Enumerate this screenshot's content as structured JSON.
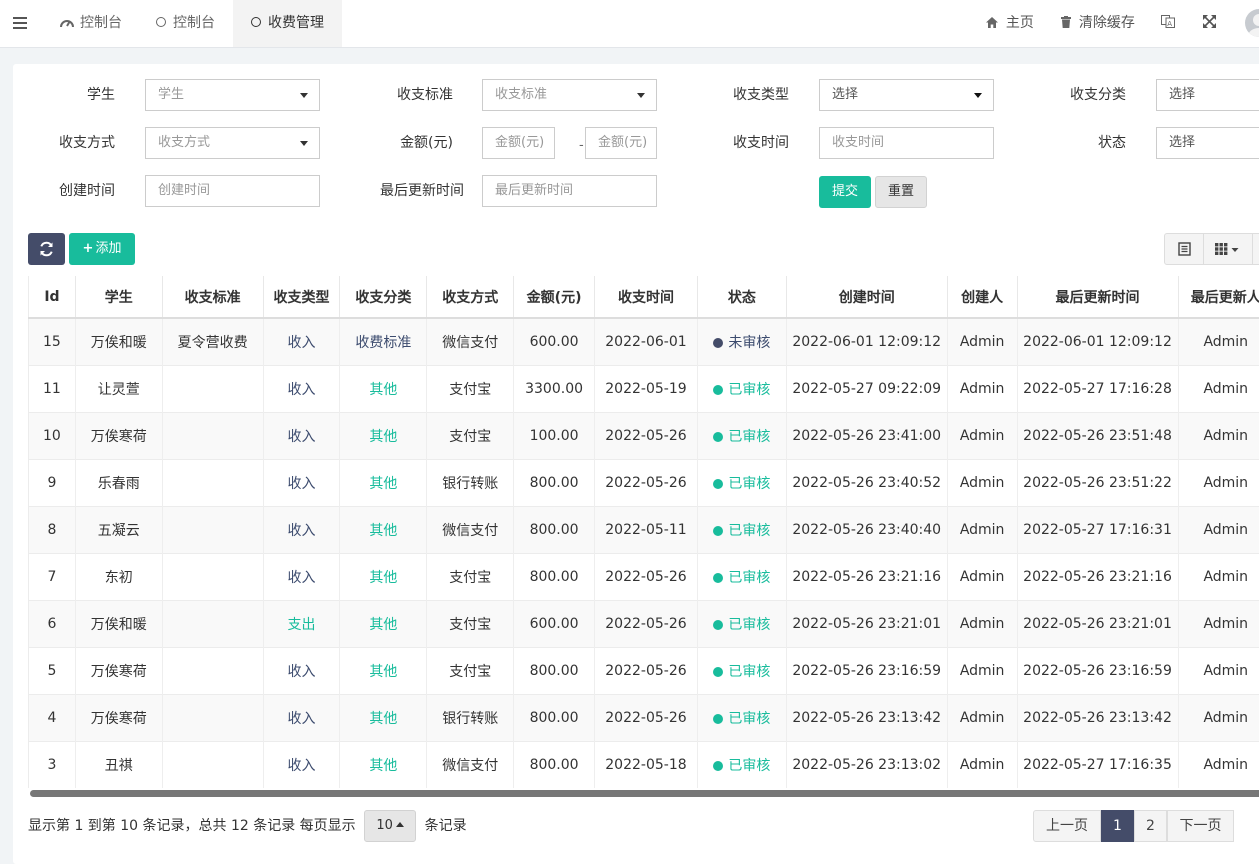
{
  "header": {
    "tabs": [
      {
        "label": "控制台",
        "icon": "dashboard-icon",
        "active": false
      },
      {
        "label": "控制台",
        "icon": "circle-icon",
        "active": false
      },
      {
        "label": "收费管理",
        "icon": "circle-icon",
        "active": true
      }
    ],
    "home_label": "主页",
    "clear_cache_label": "清除缓存"
  },
  "filters": {
    "student": {
      "label": "学生",
      "placeholder": "学生"
    },
    "standard": {
      "label": "收支标准",
      "placeholder": "收支标准"
    },
    "type": {
      "label": "收支类型",
      "value": "选择"
    },
    "category": {
      "label": "收支分类",
      "value": "选择"
    },
    "method": {
      "label": "收支方式",
      "placeholder": "收支方式"
    },
    "amount": {
      "label": "金额(元)",
      "min_placeholder": "金额(元)",
      "max_placeholder": "金额(元)",
      "separator": "-"
    },
    "time": {
      "label": "收支时间",
      "placeholder": "收支时间"
    },
    "status": {
      "label": "状态",
      "value": "选择"
    },
    "created": {
      "label": "创建时间",
      "placeholder": "创建时间"
    },
    "updated": {
      "label": "最后更新时间",
      "placeholder": "最后更新时间"
    },
    "submit_label": "提交",
    "reset_label": "重置"
  },
  "toolbar": {
    "add_label": "添加"
  },
  "table": {
    "headers": [
      "Id",
      "学生",
      "收支标准",
      "收支类型",
      "收支分类",
      "收支方式",
      "金额(元)",
      "收支时间",
      "状态",
      "创建时间",
      "创建人",
      "最后更新时间",
      "最后更新人"
    ],
    "rows": [
      {
        "id": "15",
        "student": "万俟和暖",
        "standard": "夏令营收费",
        "type": "收入",
        "category": "收费标准",
        "method": "微信支付",
        "amount": "600.00",
        "date": "2022-06-01",
        "status": "未审核",
        "created": "2022-06-01 12:09:12",
        "creator": "Admin",
        "updated": "2022-06-01 12:09:12",
        "updater": "Admin"
      },
      {
        "id": "11",
        "student": "让灵萱",
        "standard": "",
        "type": "收入",
        "category": "其他",
        "method": "支付宝",
        "amount": "3300.00",
        "date": "2022-05-19",
        "status": "已审核",
        "created": "2022-05-27 09:22:09",
        "creator": "Admin",
        "updated": "2022-05-27 17:16:28",
        "updater": "Admin"
      },
      {
        "id": "10",
        "student": "万俟寒荷",
        "standard": "",
        "type": "收入",
        "category": "其他",
        "method": "支付宝",
        "amount": "100.00",
        "date": "2022-05-26",
        "status": "已审核",
        "created": "2022-05-26 23:41:00",
        "creator": "Admin",
        "updated": "2022-05-26 23:51:48",
        "updater": "Admin"
      },
      {
        "id": "9",
        "student": "乐春雨",
        "standard": "",
        "type": "收入",
        "category": "其他",
        "method": "银行转账",
        "amount": "800.00",
        "date": "2022-05-26",
        "status": "已审核",
        "created": "2022-05-26 23:40:52",
        "creator": "Admin",
        "updated": "2022-05-26 23:51:22",
        "updater": "Admin"
      },
      {
        "id": "8",
        "student": "五凝云",
        "standard": "",
        "type": "收入",
        "category": "其他",
        "method": "微信支付",
        "amount": "800.00",
        "date": "2022-05-11",
        "status": "已审核",
        "created": "2022-05-26 23:40:40",
        "creator": "Admin",
        "updated": "2022-05-27 17:16:31",
        "updater": "Admin"
      },
      {
        "id": "7",
        "student": "东初",
        "standard": "",
        "type": "收入",
        "category": "其他",
        "method": "支付宝",
        "amount": "800.00",
        "date": "2022-05-26",
        "status": "已审核",
        "created": "2022-05-26 23:21:16",
        "creator": "Admin",
        "updated": "2022-05-26 23:21:16",
        "updater": "Admin"
      },
      {
        "id": "6",
        "student": "万俟和暖",
        "standard": "",
        "type": "支出",
        "category": "其他",
        "method": "支付宝",
        "amount": "600.00",
        "date": "2022-05-26",
        "status": "已审核",
        "created": "2022-05-26 23:21:01",
        "creator": "Admin",
        "updated": "2022-05-26 23:21:01",
        "updater": "Admin"
      },
      {
        "id": "5",
        "student": "万俟寒荷",
        "standard": "",
        "type": "收入",
        "category": "其他",
        "method": "支付宝",
        "amount": "800.00",
        "date": "2022-05-26",
        "status": "已审核",
        "created": "2022-05-26 23:16:59",
        "creator": "Admin",
        "updated": "2022-05-26 23:16:59",
        "updater": "Admin"
      },
      {
        "id": "4",
        "student": "万俟寒荷",
        "standard": "",
        "type": "收入",
        "category": "其他",
        "method": "银行转账",
        "amount": "800.00",
        "date": "2022-05-26",
        "status": "已审核",
        "created": "2022-05-26 23:13:42",
        "creator": "Admin",
        "updated": "2022-05-26 23:13:42",
        "updater": "Admin"
      },
      {
        "id": "3",
        "student": "丑祺",
        "standard": "",
        "type": "收入",
        "category": "其他",
        "method": "微信支付",
        "amount": "800.00",
        "date": "2022-05-18",
        "status": "已审核",
        "created": "2022-05-26 23:13:02",
        "creator": "Admin",
        "updated": "2022-05-27 17:16:35",
        "updater": "Admin"
      }
    ]
  },
  "pagination": {
    "info_text": "显示第 1 到第 10 条记录，总共 12 条记录 每页显示",
    "page_size": "10",
    "suffix": "条记录",
    "prev_label": "上一页",
    "pages": [
      "1",
      "2"
    ],
    "next_label": "下一页"
  },
  "colors": {
    "primary_dark": "#444c69",
    "success": "#18bc9c",
    "unreviewed_dot": "#444c69"
  }
}
